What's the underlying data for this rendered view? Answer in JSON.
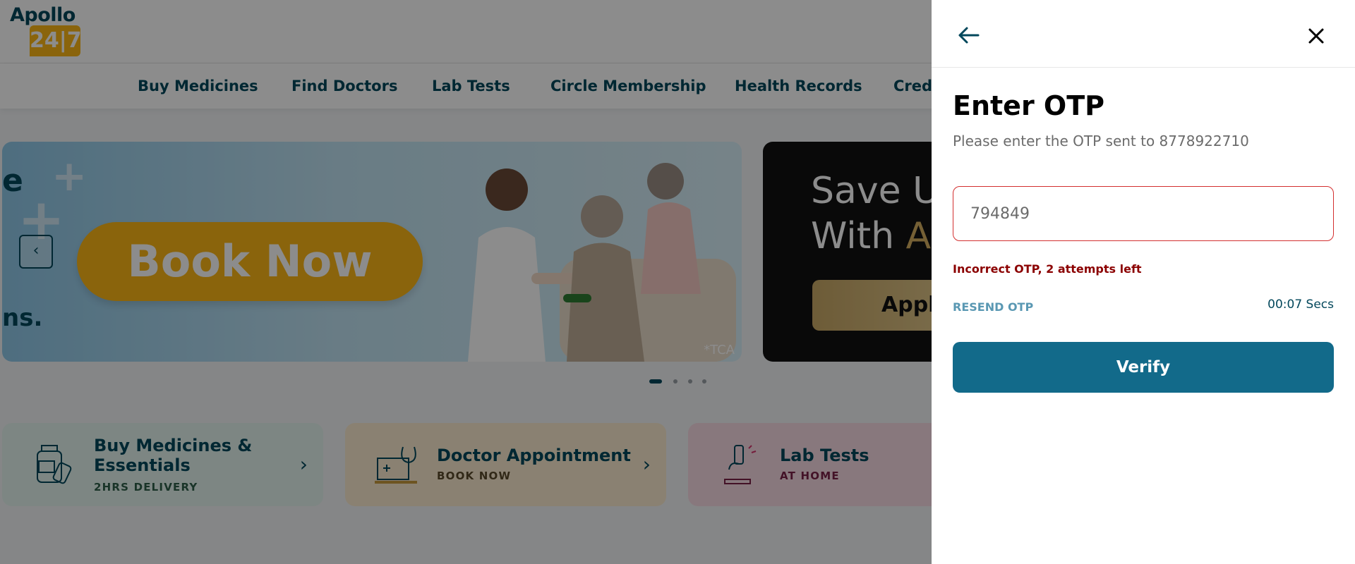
{
  "brand": {
    "logo_text": "Apollo",
    "logo_badge": "24|7",
    "primary_color": "#02475b",
    "accent_color": "#fcb716"
  },
  "nav": {
    "items": [
      {
        "label": "Buy Medicines"
      },
      {
        "label": "Find Doctors"
      },
      {
        "label": "Lab Tests"
      },
      {
        "label": "Circle Membership"
      },
      {
        "label": "Health Records"
      },
      {
        "label": "Credi"
      }
    ]
  },
  "banners": {
    "first": {
      "partial_text_top": "e",
      "partial_text_bottom": "ns.",
      "cta": "Book Now",
      "footnote": "*TCA"
    },
    "second": {
      "line1": "Save Up",
      "line2_prefix": "With ",
      "line2_accent": "Ap",
      "cta": "Apply"
    },
    "carousel_dots": {
      "count": 4,
      "active_index": 0
    }
  },
  "cards": [
    {
      "title": "Buy Medicines & Essentials",
      "subtitle": "2HRS DELIVERY",
      "icon": "medicine-bottle-icon",
      "bg": "#e4f4ee",
      "sub_color": "#2f5f49"
    },
    {
      "title": "Doctor Appointment",
      "subtitle": "BOOK NOW",
      "icon": "laptop-stethoscope-icon",
      "bg": "#fbecd0",
      "sub_color": "#5a4a2a"
    },
    {
      "title": "Lab Tests",
      "subtitle": "AT HOME",
      "icon": "microscope-icon",
      "bg": "#f7dbe4",
      "sub_color": "#7a2147"
    }
  ],
  "drawer": {
    "title": "Enter OTP",
    "description": "Please enter the OTP sent to 8778922710",
    "otp_value": "794849",
    "error": "Incorrect OTP, 2 attempts left",
    "resend_label": "RESEND OTP",
    "timer": "00:07 Secs",
    "verify_label": "Verify",
    "back_icon": "arrow-left-icon",
    "close_icon": "close-icon",
    "error_color": "#d32f2f",
    "button_color": "#126a8a"
  }
}
